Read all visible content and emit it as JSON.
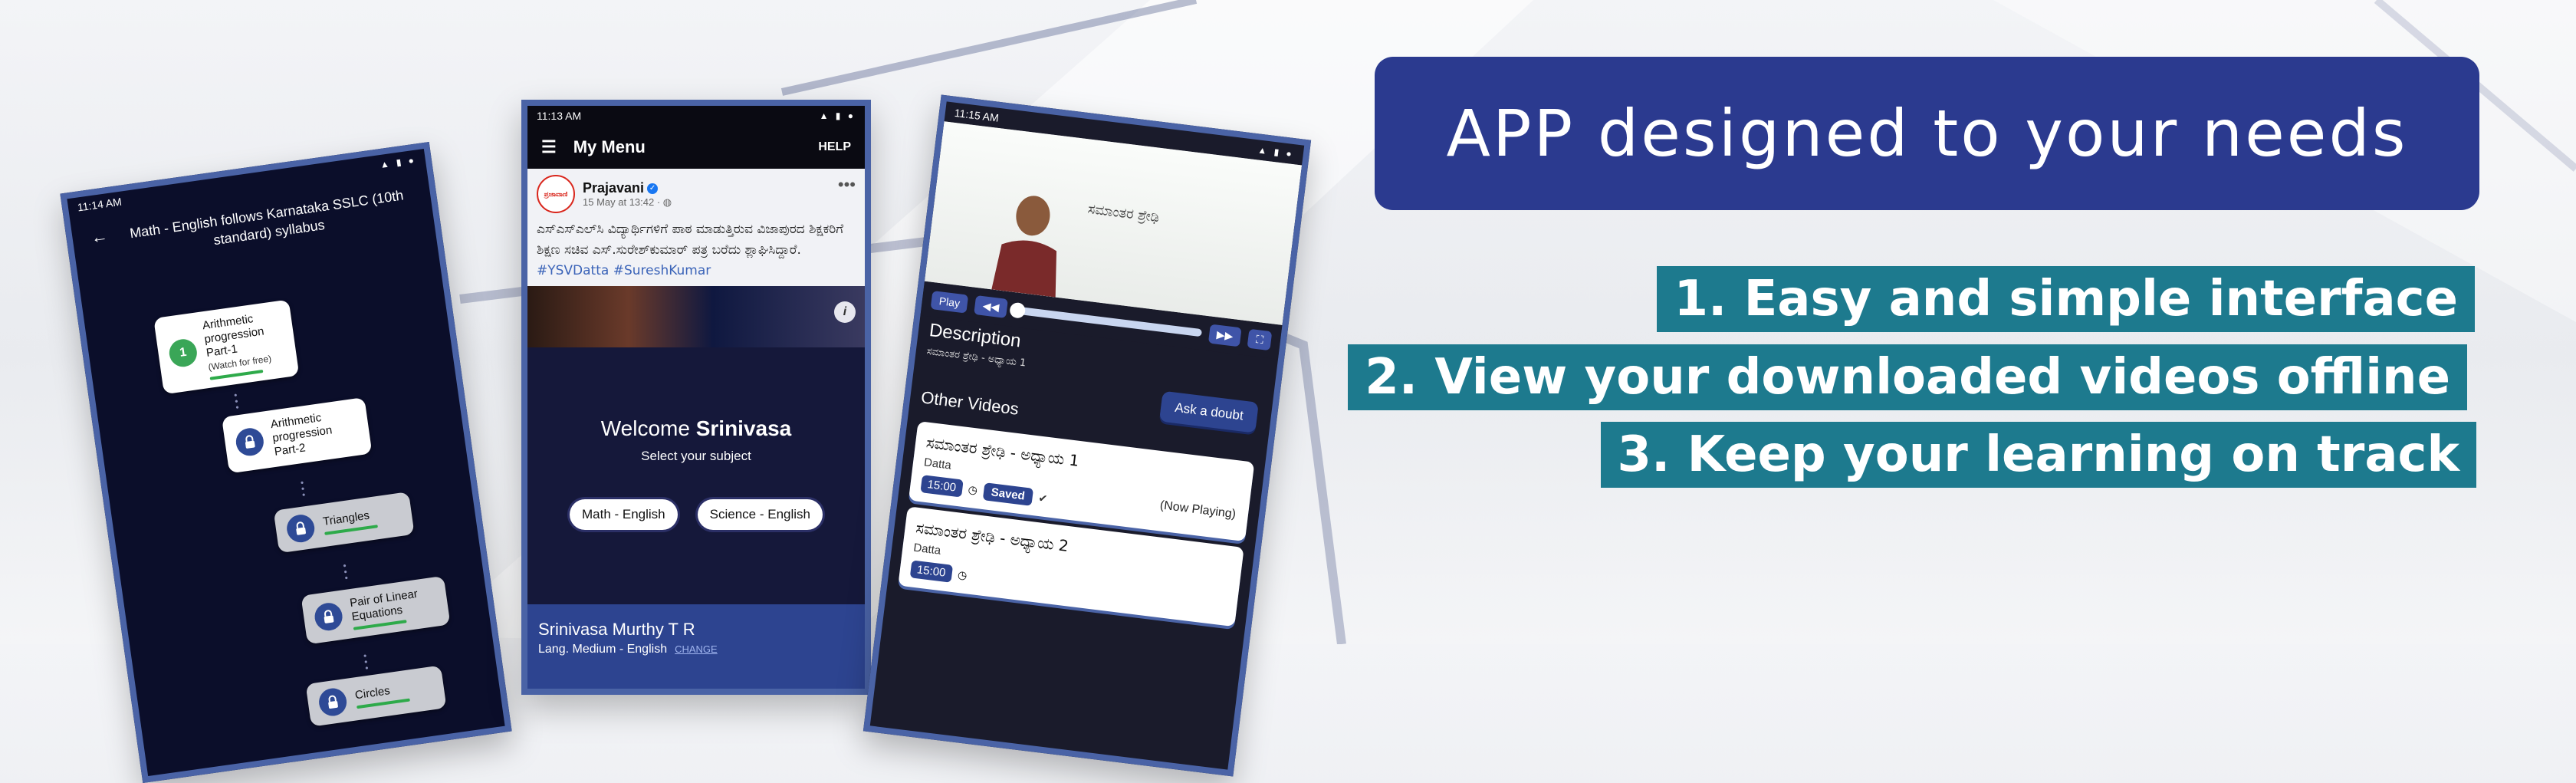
{
  "banner": {
    "title": "APP designed to your needs",
    "features": [
      "1. Easy and simple interface",
      "2. View your downloaded videos offline",
      "3. Keep your learning on track"
    ],
    "colors": {
      "title_bg": "#2b3a8f",
      "feature_bg": "#1d7a8e",
      "phone_frame": "#4a63a6"
    }
  },
  "phone1": {
    "time": "11:14 AM",
    "header": "Math - English follows Karnataka SSLC (10th standard) syllabus",
    "topics": [
      {
        "badge": "1",
        "title": "Arithmetic progression Part-1",
        "note": "(Watch for free)",
        "status": "unlocked"
      },
      {
        "title": "Arithmetic progression Part-2",
        "status": "locked"
      },
      {
        "title": "Triangles",
        "status": "locked"
      },
      {
        "title": "Pair of Linear Equations",
        "status": "locked"
      },
      {
        "title": "Circles",
        "status": "locked"
      }
    ]
  },
  "phone2": {
    "time": "11:13 AM",
    "appbar_title": "My Menu",
    "help": "HELP",
    "post": {
      "logo_text": "ಪ್ರಜಾವಾಣಿ",
      "name": "Prajavani",
      "date": "15 May at 13:42 · ",
      "text": "ಎಸ್‌ಎಸ್‌ಎಲ್‌ಸಿ ವಿದ್ಯಾರ್ಥಿಗಳಿಗೆ ಪಾಠ ಮಾಡುತ್ತಿರುವ ವಿಜಾಪುರದ ಶಿಕ್ಷಕರಿಗೆ ಶಿಕ್ಷಣ ಸಚಿವ ಎಸ್.ಸುರೇಶ್‌ಕುಮಾರ್ ಪತ್ರ ಬರೆದು ಶ್ಲಾಘಿಸಿದ್ದಾರೆ.",
      "tags": "#YSVDatta #SureshKumar"
    },
    "welcome_prefix": "Welcome ",
    "welcome_name": "Srinivasa",
    "select_subject": "Select your subject",
    "subjects": [
      "Math - English",
      "Science - English"
    ],
    "profile": {
      "name": "Srinivasa Murthy T R",
      "medium": "Lang. Medium - English",
      "change": "CHANGE"
    }
  },
  "phone3": {
    "time": "11:15 AM",
    "board_text": "ಸಮಾಂತರ ಶ್ರೇಢಿ",
    "controls": {
      "play": "Play",
      "rewind": "◀◀",
      "forward": "▶▶",
      "fullscreen": "⛶"
    },
    "description_title": "Description",
    "description_text": "ಸಮಾಂತರ ಶ್ರೇಢಿ - ಅಧ್ಯಾಯ 1",
    "ask_doubt": "Ask a doubt",
    "other_videos": "Other Videos",
    "videos": [
      {
        "title": "ಸಮಾಂತರ ಶ್ರೇಢಿ - ಅಧ್ಯಾಯ 1",
        "author": "Datta",
        "duration": "15:00",
        "saved": "Saved",
        "now_playing": "(Now Playing)"
      },
      {
        "title": "ಸಮಾಂತರ ಶ್ರೇಢಿ - ಅಧ್ಯಾಯ 2",
        "author": "Datta",
        "duration": "15:00"
      }
    ]
  }
}
